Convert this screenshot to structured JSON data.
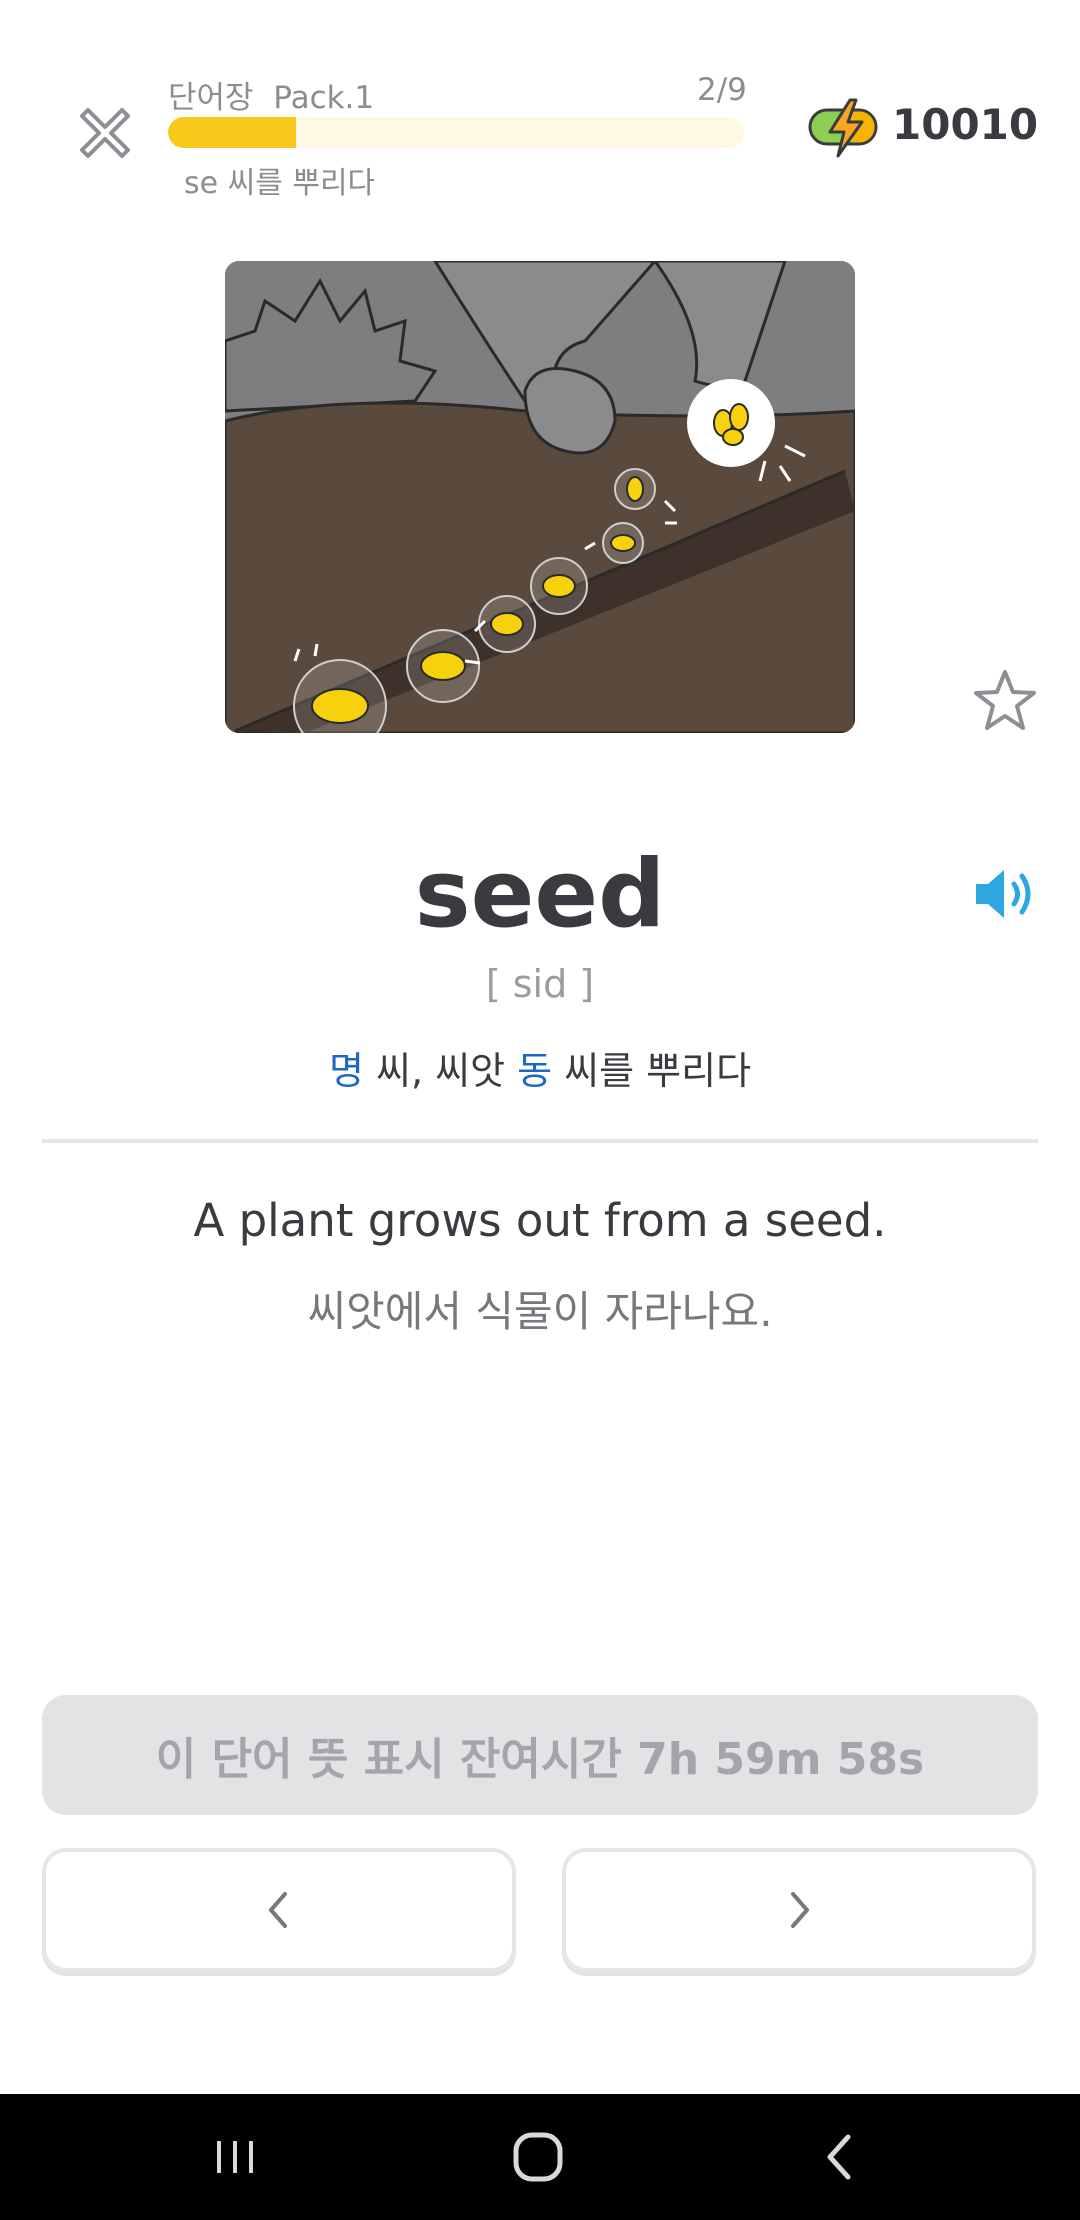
{
  "header": {
    "close_icon": "close-x-icon",
    "pack_label": "단어장  Pack.1",
    "progress_text": "2/9",
    "progress_fraction": 0.2222,
    "subtitle": "se 씨를 뿌리다",
    "energy_icon": "battery-lightning-icon",
    "energy_count": "10010"
  },
  "card": {
    "illustration_icon": "planting-seeds-illustration",
    "star_icon": "star-outline-icon",
    "speaker_icon": "speaker-icon",
    "word": "seed",
    "pronunciation": "[ sid ]",
    "pos_noun": "명",
    "meaning_noun": " 씨, 씨앗 ",
    "pos_verb": "동",
    "meaning_verb": " 씨를 뿌리다",
    "example_en": "A plant grows out from a seed.",
    "example_ko": "씨앗에서 식물이 자라나요."
  },
  "controls": {
    "timer_label": "이 단어 뜻 표시 잔여시간 7h 59m 58s",
    "prev_icon": "chevron-left-icon",
    "next_icon": "chevron-right-icon"
  },
  "system_nav": {
    "recent_icon": "recent-apps-icon",
    "home_icon": "home-icon",
    "back_icon": "back-icon"
  },
  "colors": {
    "accent_yellow": "#f9c81c",
    "progress_track": "#fff8e2",
    "pos_blue": "#2066c6",
    "speaker_blue": "#2ea7e0",
    "text_dark": "#3a3b40",
    "text_gray": "#8c8d92",
    "button_gray": "#e3e3e5"
  }
}
